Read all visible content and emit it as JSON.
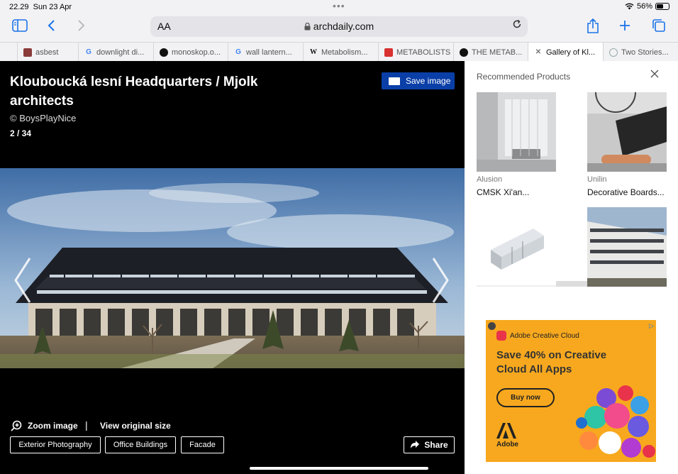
{
  "status": {
    "time": "22.29",
    "date": "Sun 23 Apr",
    "battery": "56%"
  },
  "toolbar": {
    "aa": "AA",
    "url": "archdaily.com"
  },
  "tabs": [
    {
      "label": "asbest",
      "favicon": "book-icon"
    },
    {
      "label": "downlight di...",
      "favicon": "google-icon"
    },
    {
      "label": "monoskop.o...",
      "favicon": "monoskop-icon"
    },
    {
      "label": "wall lantern...",
      "favicon": "google-icon"
    },
    {
      "label": "Metabolism...",
      "favicon": "wikipedia-icon"
    },
    {
      "label": "METABOLISTS",
      "favicon": "red-square-icon"
    },
    {
      "label": "THE METAB...",
      "favicon": "black-circle-icon"
    },
    {
      "label": "Gallery of Kl...",
      "favicon": "close-icon",
      "active": true
    },
    {
      "label": "Two Stories...",
      "favicon": "archdaily-icon"
    }
  ],
  "gallery": {
    "title": "Klouboucká lesní Headquarters / Mjolk architects",
    "credit": "© BoysPlayNice",
    "counter": "2 / 34",
    "save_label": "Save image",
    "zoom_label": "Zoom image",
    "separator": "|",
    "original_label": "View original size",
    "tags": [
      "Exterior Photography",
      "Office Buildings",
      "Facade"
    ],
    "share_label": "Share"
  },
  "side": {
    "title": "Recommended Products",
    "products": [
      {
        "brand": "Alusion",
        "name": "CMSK Xi'an..."
      },
      {
        "brand": "Unilin",
        "name": "Decorative Boards..."
      }
    ]
  },
  "ad": {
    "brand_line": "Adobe Creative Cloud",
    "headline": "Save 40% on Creative Cloud All Apps",
    "cta": "Buy now",
    "logo_text": "Adobe",
    "accent": "#f7a81e"
  },
  "colors": {
    "save_button": "#0a3fa8",
    "link_blue": "#1a73e8"
  }
}
